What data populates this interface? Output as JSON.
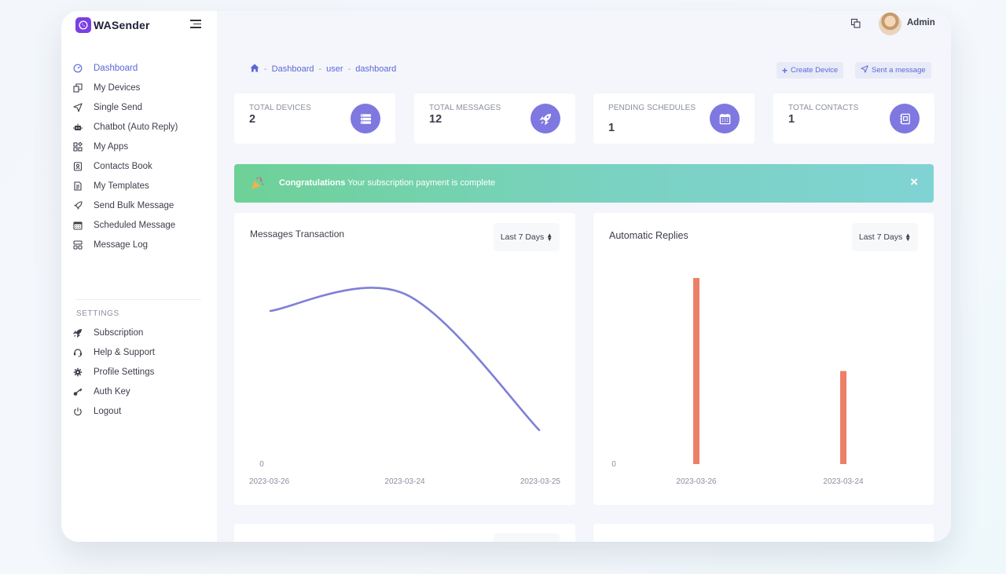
{
  "brand": {
    "name": "WASender"
  },
  "header": {
    "user_name": "Admin"
  },
  "sidebar": {
    "items": [
      {
        "label": "Dashboard",
        "icon": "dashboard-icon",
        "active": true
      },
      {
        "label": "My Devices",
        "icon": "devices-icon"
      },
      {
        "label": "Single Send",
        "icon": "send-icon"
      },
      {
        "label": "Chatbot (Auto Reply)",
        "icon": "robot-icon"
      },
      {
        "label": "My Apps",
        "icon": "apps-icon"
      },
      {
        "label": "Contacts Book",
        "icon": "contacts-icon"
      },
      {
        "label": "My Templates",
        "icon": "template-icon"
      },
      {
        "label": "Send Bulk Message",
        "icon": "rocket-icon"
      },
      {
        "label": "Scheduled Message",
        "icon": "calendar-icon"
      },
      {
        "label": "Message Log",
        "icon": "log-icon"
      }
    ],
    "settings_label": "SETTINGS",
    "settings_items": [
      {
        "label": "Subscription",
        "icon": "subscription-icon"
      },
      {
        "label": "Help & Support",
        "icon": "support-icon"
      },
      {
        "label": "Profile Settings",
        "icon": "gear-icon"
      },
      {
        "label": "Auth Key",
        "icon": "key-icon"
      },
      {
        "label": "Logout",
        "icon": "power-icon"
      }
    ]
  },
  "breadcrumb": [
    "Dashboard",
    "user",
    "dashboard"
  ],
  "actions": {
    "create_device": "Create Device",
    "sent_message": "Sent a message"
  },
  "stats": [
    {
      "label": "TOTAL DEVICES",
      "value": "2",
      "icon": "server-icon"
    },
    {
      "label": "TOTAL MESSAGES",
      "value": "12",
      "icon": "rocket-icon"
    },
    {
      "label": "PENDING SCHEDULES",
      "value": "1",
      "icon": "calendar-icon"
    },
    {
      "label": "TOTAL CONTACTS",
      "value": "1",
      "icon": "contacts-icon"
    }
  ],
  "alert": {
    "strong": "Congratulations",
    "text": " Your subscription payment is complete",
    "close": "×"
  },
  "charts": {
    "messages": {
      "title": "Messages Transaction",
      "range": "Last 7 Days"
    },
    "replies": {
      "title": "Automatic Replies",
      "range": "Last 7 Days"
    }
  },
  "colors": {
    "accent": "#5b67d8",
    "badge": "#7f78e0",
    "line": "#7f7fd8",
    "bar": "#ec8067"
  },
  "chart_data": [
    {
      "type": "line",
      "title": "Messages Transaction",
      "x": [
        "2023-03-26",
        "2023-03-24",
        "2023-03-25"
      ],
      "y_tick_labels": [
        "0"
      ],
      "series": [
        {
          "values": [
            9,
            10,
            2
          ]
        }
      ],
      "ylim": [
        0,
        12
      ]
    },
    {
      "type": "bar",
      "title": "Automatic Replies",
      "categories": [
        "2023-03-26",
        "2023-03-24"
      ],
      "y_tick_labels": [
        "0"
      ],
      "series": [
        {
          "values": [
            10,
            5
          ]
        }
      ],
      "ylim": [
        0,
        10
      ]
    }
  ]
}
